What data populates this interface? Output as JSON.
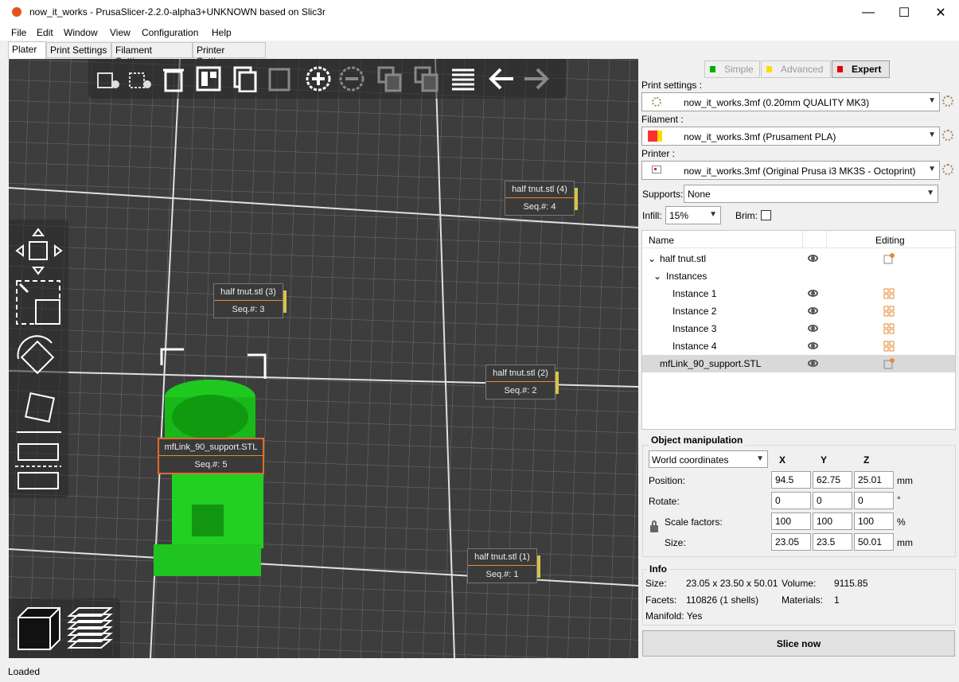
{
  "window": {
    "title": "now_it_works - PrusaSlicer-2.2.0-alpha3+UNKNOWN based on Slic3r",
    "minimize": "—",
    "maximize": "☐",
    "close": "✕"
  },
  "menu": [
    "File",
    "Edit",
    "Window",
    "View",
    "Configuration",
    "Help"
  ],
  "tabs": [
    "Plater",
    "Print Settings",
    "Filament Settings",
    "Printer Settings"
  ],
  "canvas": {
    "labels": [
      {
        "name": "half tnut.stl (4)",
        "seq": "Seq.#: 4"
      },
      {
        "name": "half tnut.stl (3)",
        "seq": "Seq.#: 3"
      },
      {
        "name": "half tnut.stl (2)",
        "seq": "Seq.#: 2"
      },
      {
        "name": "mfLink_90_support.STL",
        "seq": "Seq.#: 5"
      },
      {
        "name": "half tnut.stl (1)",
        "seq": "Seq.#: 1"
      }
    ]
  },
  "modes": {
    "simple": "Simple",
    "advanced": "Advanced",
    "expert": "Expert",
    "colors": {
      "simple": "#00b000",
      "advanced": "#ffdc00",
      "expert": "#e00000"
    }
  },
  "presets": {
    "print_label": "Print settings :",
    "print_value": "now_it_works.3mf (0.20mm QUALITY MK3)",
    "filament_label": "Filament :",
    "filament_value": "now_it_works.3mf (Prusament PLA)",
    "printer_label": "Printer :",
    "printer_value": "now_it_works.3mf (Original Prusa i3 MK3S - Octoprint)",
    "supports_label": "Supports:",
    "supports_value": "None",
    "infill_label": "Infill:",
    "infill_value": "15%",
    "brim_label": "Brim:"
  },
  "object_list": {
    "col_name": "Name",
    "col_editing": "Editing",
    "rows": [
      {
        "name": "half tnut.stl"
      },
      {
        "name": "Instances"
      },
      {
        "name": "Instance 1"
      },
      {
        "name": "Instance 2"
      },
      {
        "name": "Instance 3"
      },
      {
        "name": "Instance 4"
      },
      {
        "name": "mfLink_90_support.STL"
      }
    ]
  },
  "manipulation": {
    "title": "Object manipulation",
    "coords": "World coordinates",
    "x": "X",
    "y": "Y",
    "z": "Z",
    "position_label": "Position:",
    "position": [
      "94.5",
      "62.75",
      "25.01"
    ],
    "position_unit": "mm",
    "rotate_label": "Rotate:",
    "rotate": [
      "0",
      "0",
      "0"
    ],
    "rotate_unit": "°",
    "scale_label": "Scale factors:",
    "scale": [
      "100",
      "100",
      "100"
    ],
    "scale_unit": "%",
    "size_label": "Size:",
    "size": [
      "23.05",
      "23.5",
      "50.01"
    ],
    "size_unit": "mm"
  },
  "info": {
    "title": "Info",
    "size_label": "Size:",
    "size": "23.05 x 23.50 x 50.01",
    "volume_label": "Volume:",
    "volume": "9115.85",
    "facets_label": "Facets:",
    "facets": "110826 (1 shells)",
    "materials_label": "Materials:",
    "materials": "1",
    "manifold": "Manifold: Yes"
  },
  "slice_button": "Slice now",
  "status": "Loaded"
}
